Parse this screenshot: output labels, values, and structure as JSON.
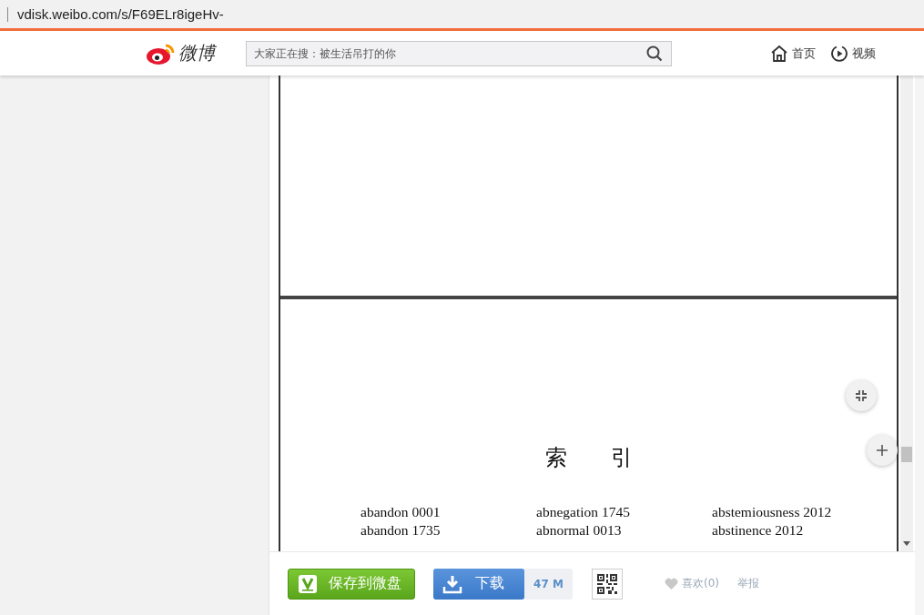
{
  "address_bar": {
    "url": "vdisk.weibo.com/s/F69ELr8igeHv-"
  },
  "header": {
    "logo_text": "微博",
    "search": {
      "placeholder": "大家正在搜：被生活吊打的你"
    },
    "nav": [
      {
        "label": "首页",
        "kind": "home"
      },
      {
        "label": "视频",
        "kind": "video"
      }
    ]
  },
  "document": {
    "index_title": "索　　引",
    "index_rows": [
      [
        "abandon 0001",
        "abnegation 1745",
        "abstemiousness 2012"
      ],
      [
        "abandon 1735",
        "abnormal 0013",
        "abstinence 2012"
      ]
    ]
  },
  "actions": {
    "save_button": "保存到微盘",
    "download_button": "下载",
    "file_size": "47 M",
    "like": "喜欢(0)",
    "report": "举报"
  }
}
